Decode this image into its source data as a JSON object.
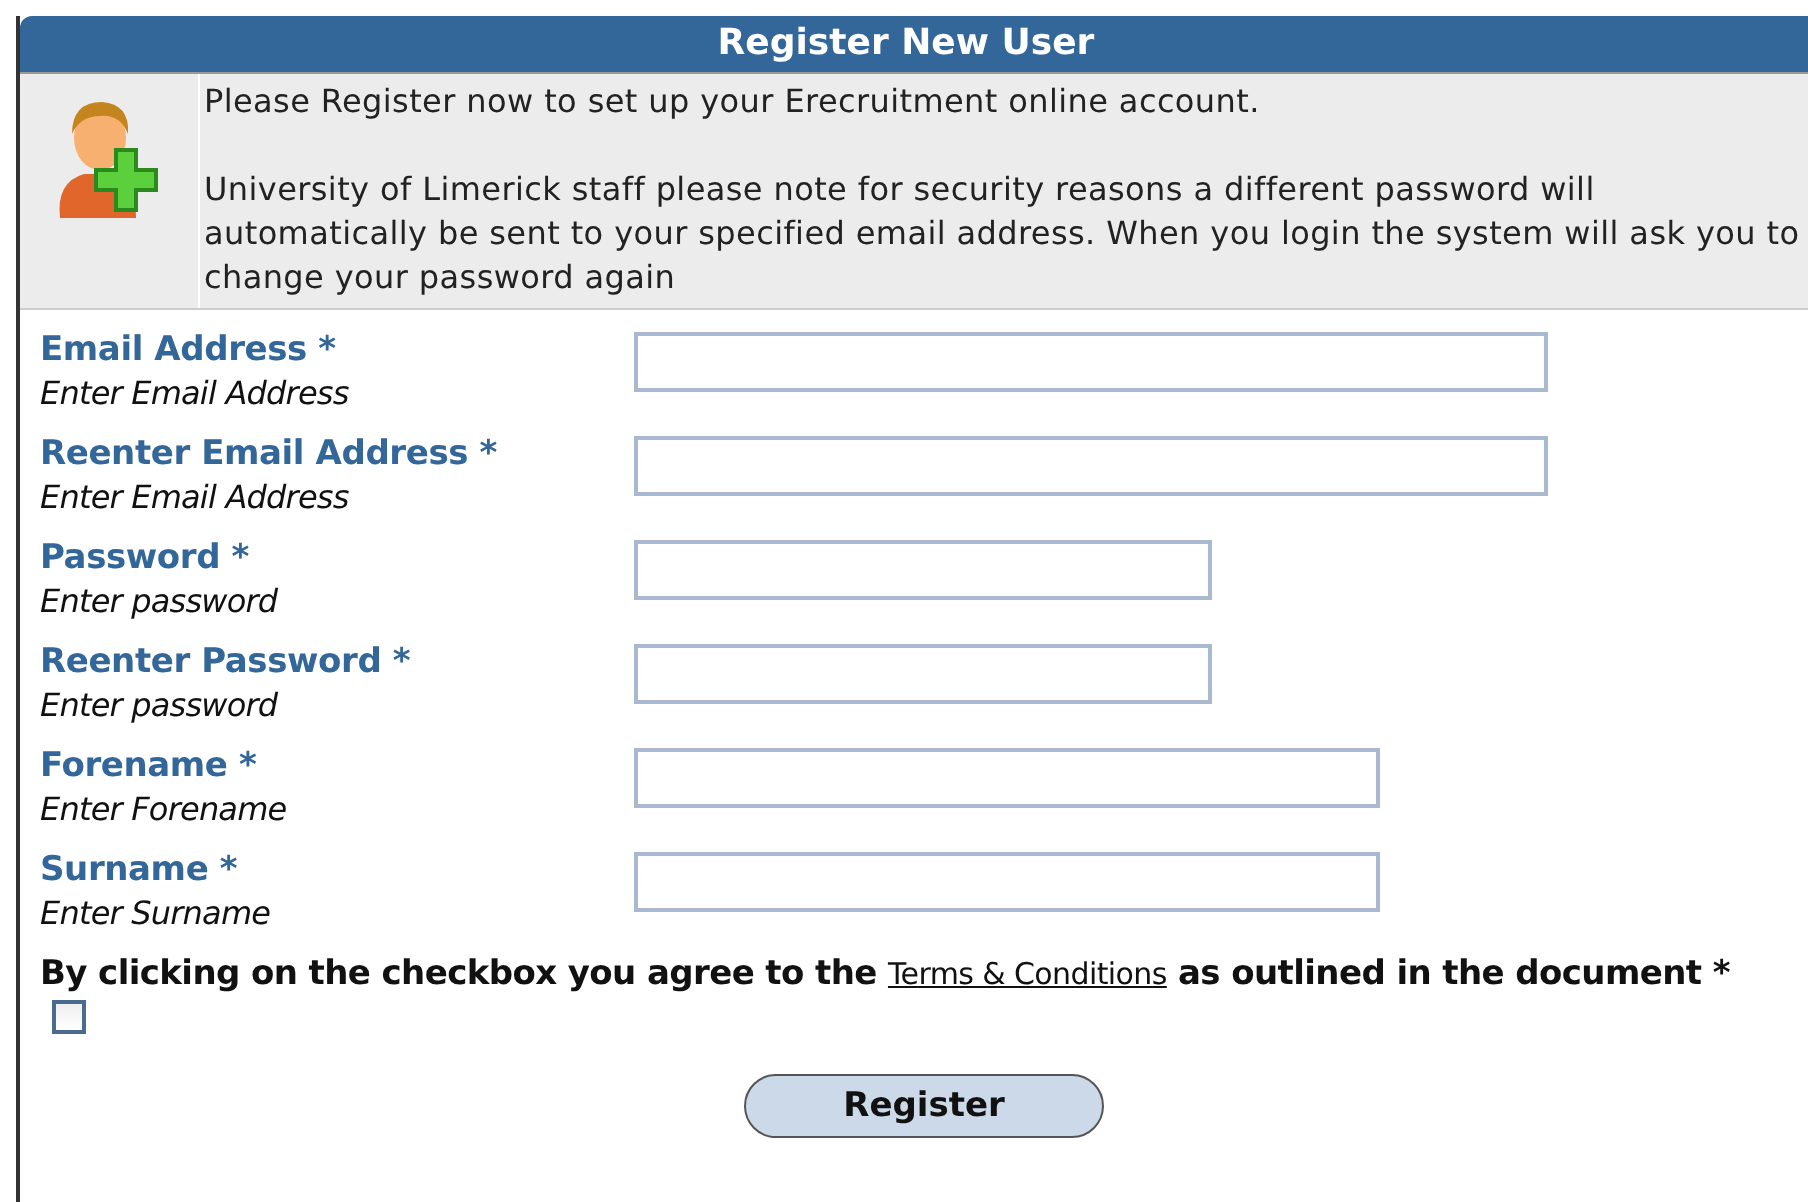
{
  "title": "Register New User",
  "intro": [
    "Please Register now to set up your Erecruitment online account.",
    "University of Limerick staff please note for security reasons a different password will automatically be sent to your specified email address. When you login the system will ask you to change your password again"
  ],
  "fields": [
    {
      "label": "Email Address *",
      "hint": "Enter Email Address"
    },
    {
      "label": "Reenter Email Address *",
      "hint": "Enter Email Address"
    },
    {
      "label": "Password *",
      "hint": "Enter password"
    },
    {
      "label": "Reenter Password *",
      "hint": "Enter password"
    },
    {
      "label": "Forename *",
      "hint": "Enter Forename"
    },
    {
      "label": "Surname *",
      "hint": "Enter Surname"
    }
  ],
  "agreement": {
    "before": "By clicking on the checkbox you agree to the",
    "link": "Terms & Conditions",
    "after": "as outlined in the document *",
    "checked": false
  },
  "button": "Register"
}
